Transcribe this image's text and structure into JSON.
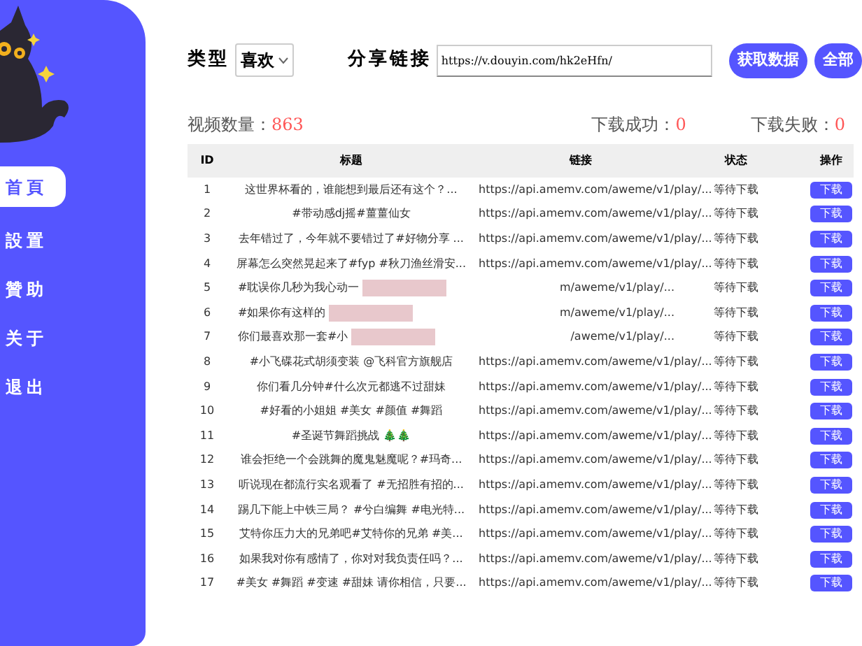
{
  "sidebar": {
    "items": [
      {
        "label": "首頁",
        "selected": true
      },
      {
        "label": "設置",
        "selected": false
      },
      {
        "label": "贊助",
        "selected": false
      },
      {
        "label": "关于",
        "selected": false
      },
      {
        "label": "退出",
        "selected": false
      }
    ]
  },
  "toolbar": {
    "type_label": "类型",
    "type_value": "喜欢",
    "link_label": "分享链接",
    "link_value": "https://v.douyin.com/hk2eHfn/",
    "buttons": [
      "获取数据",
      "全部"
    ]
  },
  "stats": {
    "count_label": "视频数量：",
    "count": "863",
    "success_label": "下载成功：",
    "success": "0",
    "fail_label": "下载失败：",
    "fail": "0"
  },
  "table": {
    "columns": [
      "ID",
      "标题",
      "链接",
      "状态",
      "操作"
    ],
    "rows": [
      {
        "id": "1",
        "title": "这世界杯看的，谁能想到最后还有这个？...",
        "link": "https://api.amemv.com/aweme/v1/play/...",
        "status": "等待下载",
        "action": "下载",
        "redacted": false
      },
      {
        "id": "2",
        "title": "#带动感dj摇#薑薑仙女",
        "link": "https://api.amemv.com/aweme/v1/play/...",
        "status": "等待下载",
        "action": "下载",
        "redacted": false
      },
      {
        "id": "3",
        "title": "去年错过了，今年就不要错过了#好物分享 ...",
        "link": "https://api.amemv.com/aweme/v1/play/...",
        "status": "等待下载",
        "action": "下载",
        "redacted": false
      },
      {
        "id": "4",
        "title": "屏幕怎么突然晃起来了#fyp #秋刀渔丝滑安...",
        "link": "https://api.amemv.com/aweme/v1/play/...",
        "status": "等待下载",
        "action": "下载",
        "redacted": false
      },
      {
        "id": "5",
        "title": "#耽误你几秒为我心动一",
        "link": "m/aweme/v1/play/...",
        "status": "等待下载",
        "action": "下载",
        "redacted": true
      },
      {
        "id": "6",
        "title": "#如果你有这样的",
        "link": "m/aweme/v1/play/...",
        "status": "等待下载",
        "action": "下载",
        "redacted": true
      },
      {
        "id": "7",
        "title": "你们最喜欢那一套#小",
        "link": "/aweme/v1/play/...",
        "status": "等待下载",
        "action": "下载",
        "redacted": true
      },
      {
        "id": "8",
        "title": "#小飞碟花式胡须变装 @飞科官方旗舰店",
        "link": "https://api.amemv.com/aweme/v1/play/...",
        "status": "等待下载",
        "action": "下载",
        "redacted": false
      },
      {
        "id": "9",
        "title": "你们看几分钟#什么次元都逃不过甜妹",
        "link": "https://api.amemv.com/aweme/v1/play/...",
        "status": "等待下载",
        "action": "下载",
        "redacted": false
      },
      {
        "id": "10",
        "title": "#好看的小姐姐 #美女 #颜值 #舞蹈",
        "link": "https://api.amemv.com/aweme/v1/play/...",
        "status": "等待下载",
        "action": "下载",
        "redacted": false
      },
      {
        "id": "11",
        "title": "#圣诞节舞蹈挑战 🎄🎄",
        "link": "https://api.amemv.com/aweme/v1/play/...",
        "status": "等待下载",
        "action": "下载",
        "redacted": false
      },
      {
        "id": "12",
        "title": "谁会拒绝一个会跳舞的魔鬼魅魔呢？#玛奇...",
        "link": "https://api.amemv.com/aweme/v1/play/...",
        "status": "等待下载",
        "action": "下载",
        "redacted": false
      },
      {
        "id": "13",
        "title": "听说现在都流行实名观看了 #无招胜有招的...",
        "link": "https://api.amemv.com/aweme/v1/play/...",
        "status": "等待下载",
        "action": "下载",
        "redacted": false
      },
      {
        "id": "14",
        "title": "踢几下能上中铁三局？ #兮白编舞 #电光特...",
        "link": "https://api.amemv.com/aweme/v1/play/...",
        "status": "等待下载",
        "action": "下载",
        "redacted": false
      },
      {
        "id": "15",
        "title": "艾特你压力大的兄弟吧#艾特你的兄弟 #美...",
        "link": "https://api.amemv.com/aweme/v1/play/...",
        "status": "等待下载",
        "action": "下载",
        "redacted": false
      },
      {
        "id": "16",
        "title": "如果我对你有感情了，你对对我负责任吗？...",
        "link": "https://api.amemv.com/aweme/v1/play/...",
        "status": "等待下载",
        "action": "下载",
        "redacted": false
      },
      {
        "id": "17",
        "title": "#美女 #舞蹈 #变速 #甜妹 请你相信，只要...",
        "link": "https://api.amemv.com/aweme/v1/play/...",
        "status": "等待下载",
        "action": "下载",
        "redacted": false
      }
    ]
  }
}
